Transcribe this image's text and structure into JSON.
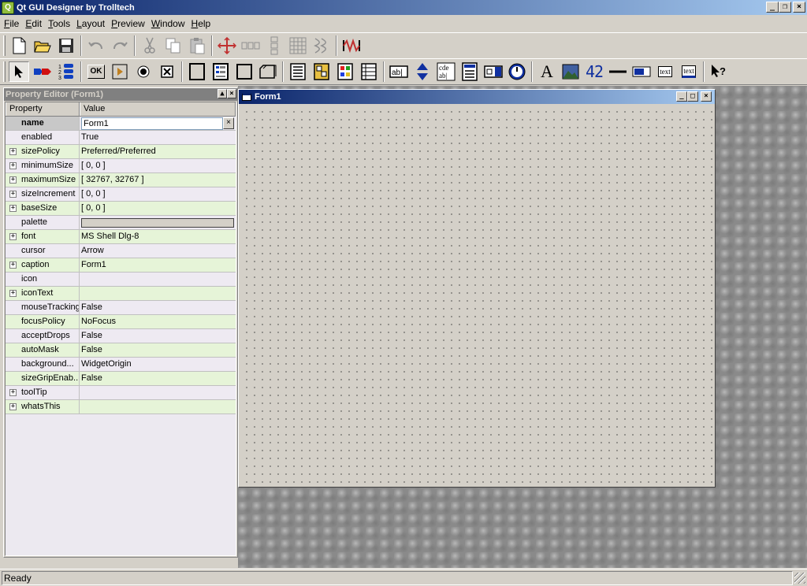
{
  "window": {
    "title": "Qt GUI Designer by Trolltech",
    "app_icon_glyph": "Q"
  },
  "menu": [
    {
      "label_u": "F",
      "label_rest": "ile"
    },
    {
      "label_u": "E",
      "label_rest": "dit"
    },
    {
      "label_u": "T",
      "label_rest": "ools"
    },
    {
      "label_u": "L",
      "label_rest": "ayout"
    },
    {
      "label_u": "P",
      "label_rest": "review"
    },
    {
      "label_u": "W",
      "label_rest": "indow"
    },
    {
      "label_u": "H",
      "label_rest": "elp"
    }
  ],
  "toolbar2_labels": {
    "ok": "OK",
    "text1": "text",
    "text2": "text",
    "lcd": "42",
    "lineedit": "ab|",
    "textedit_top": "cde",
    "textedit_bottom": "ab|",
    "label_a": "A"
  },
  "property_editor": {
    "title": "Property Editor (Form1)",
    "col_property": "Property",
    "col_value": "Value",
    "rows": [
      {
        "name": "name",
        "value": "Form1",
        "expandable": false
      },
      {
        "name": "enabled",
        "value": "True",
        "expandable": false
      },
      {
        "name": "sizePolicy",
        "value": "Preferred/Preferred",
        "expandable": true
      },
      {
        "name": "minimumSize",
        "value": "[ 0, 0 ]",
        "expandable": true
      },
      {
        "name": "maximumSize",
        "value": "[ 32767, 32767 ]",
        "expandable": true
      },
      {
        "name": "sizeIncrement",
        "value": "[ 0, 0 ]",
        "expandable": true
      },
      {
        "name": "baseSize",
        "value": "[ 0, 0 ]",
        "expandable": true
      },
      {
        "name": "palette",
        "value": "",
        "expandable": false
      },
      {
        "name": "font",
        "value": "MS Shell Dlg-8",
        "expandable": true
      },
      {
        "name": "cursor",
        "value": "Arrow",
        "expandable": false
      },
      {
        "name": "caption",
        "value": "Form1",
        "expandable": true
      },
      {
        "name": "icon",
        "value": "",
        "expandable": false
      },
      {
        "name": "iconText",
        "value": "",
        "expandable": true
      },
      {
        "name": "mouseTracking",
        "value": "False",
        "expandable": false
      },
      {
        "name": "focusPolicy",
        "value": "NoFocus",
        "expandable": false
      },
      {
        "name": "acceptDrops",
        "value": "False",
        "expandable": false
      },
      {
        "name": "autoMask",
        "value": "False",
        "expandable": false
      },
      {
        "name": "background...",
        "value": "WidgetOrigin",
        "expandable": false
      },
      {
        "name": "sizeGripEnab...",
        "value": "False",
        "expandable": false
      },
      {
        "name": "toolTip",
        "value": "",
        "expandable": true
      },
      {
        "name": "whatsThis",
        "value": "",
        "expandable": true
      }
    ]
  },
  "form": {
    "title": "Form1"
  },
  "status": {
    "text": "Ready"
  },
  "colors": {
    "title_start": "#0a246a",
    "title_end": "#a6caf0",
    "face": "#d4d0c8",
    "row_even": "#e6f4d8",
    "row_odd": "#eeeaf2"
  }
}
